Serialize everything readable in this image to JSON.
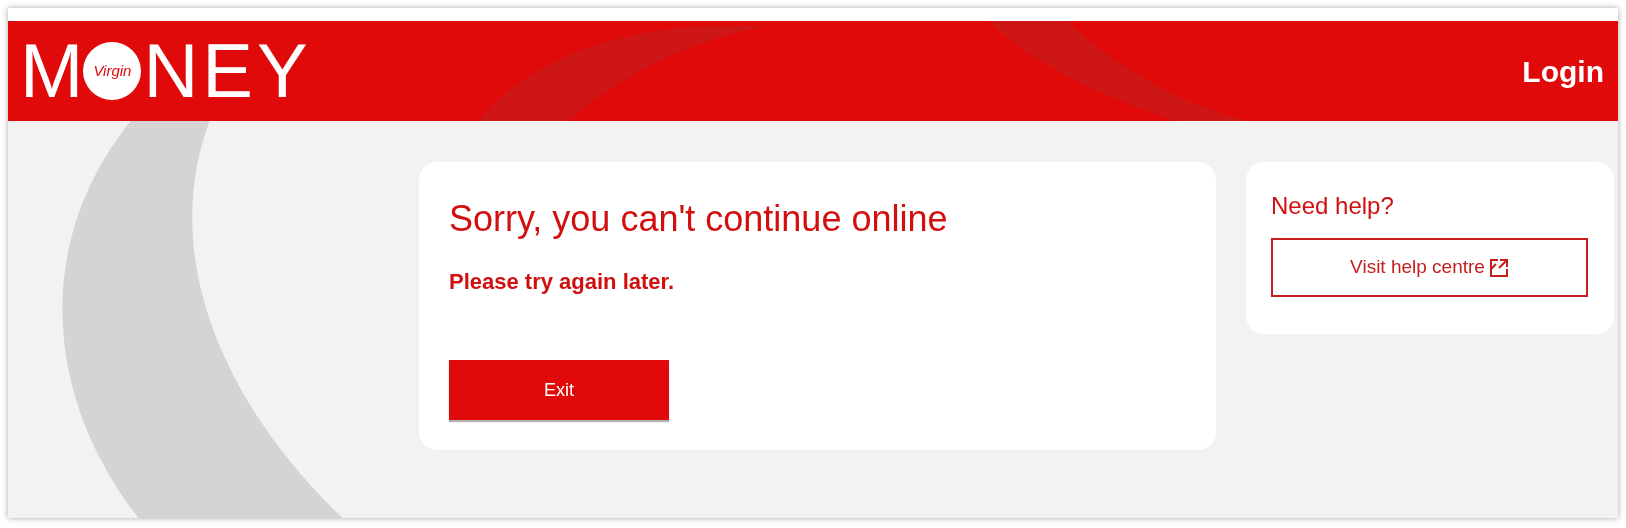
{
  "header": {
    "logo": {
      "before": "M",
      "badge": "Virgin",
      "after": "NEY"
    },
    "login": "Login"
  },
  "main_card": {
    "title": "Sorry, you can't continue online",
    "message": "Please try again later.",
    "button": "Exit"
  },
  "help_card": {
    "title": "Need help?",
    "button": "Visit help centre"
  }
}
